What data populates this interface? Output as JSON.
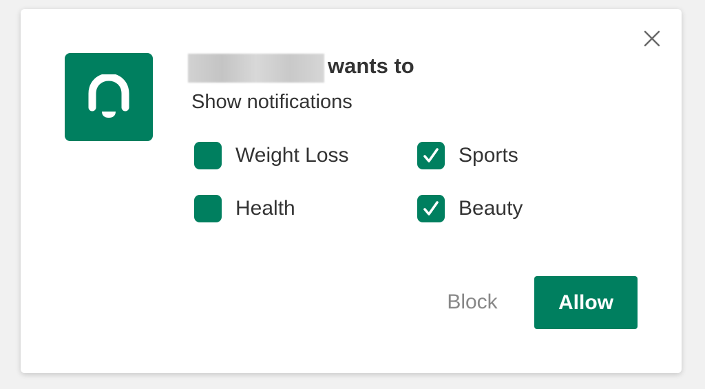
{
  "colors": {
    "accent": "#007f5f",
    "text": "#333333",
    "muted": "#888888",
    "close_icon": "#6b6b6b"
  },
  "dialog": {
    "headline": "wants to",
    "subtitle": "Show notifications",
    "app_icon": "bell-icon",
    "close_icon": "close-icon"
  },
  "options": [
    {
      "label": "Weight Loss",
      "checked": false
    },
    {
      "label": "Sports",
      "checked": true
    },
    {
      "label": "Health",
      "checked": false
    },
    {
      "label": "Beauty",
      "checked": true
    }
  ],
  "actions": {
    "block_label": "Block",
    "allow_label": "Allow"
  }
}
